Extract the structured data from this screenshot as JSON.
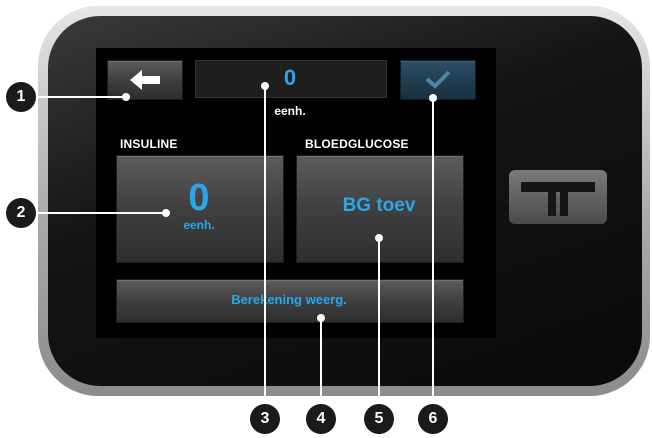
{
  "screen": {
    "value_display": "0",
    "value_unit": "eenh.",
    "insulin": {
      "label": "INSULINE",
      "value": "0",
      "unit": "eenh."
    },
    "bloodglucose": {
      "label": "BLOEDGLUCOSE",
      "button_text": "BG toev"
    },
    "calc_button": "Berekening weerg."
  },
  "icons": {
    "back": "left-arrow-icon",
    "confirm": "checkmark-icon",
    "logo": "t-logo-icon"
  },
  "callouts": [
    "1",
    "2",
    "3",
    "4",
    "5",
    "6"
  ],
  "colors": {
    "accent_text": "#2aa6e8",
    "confirm_button": "#1f3b4e",
    "screen_bg": "#000000"
  }
}
